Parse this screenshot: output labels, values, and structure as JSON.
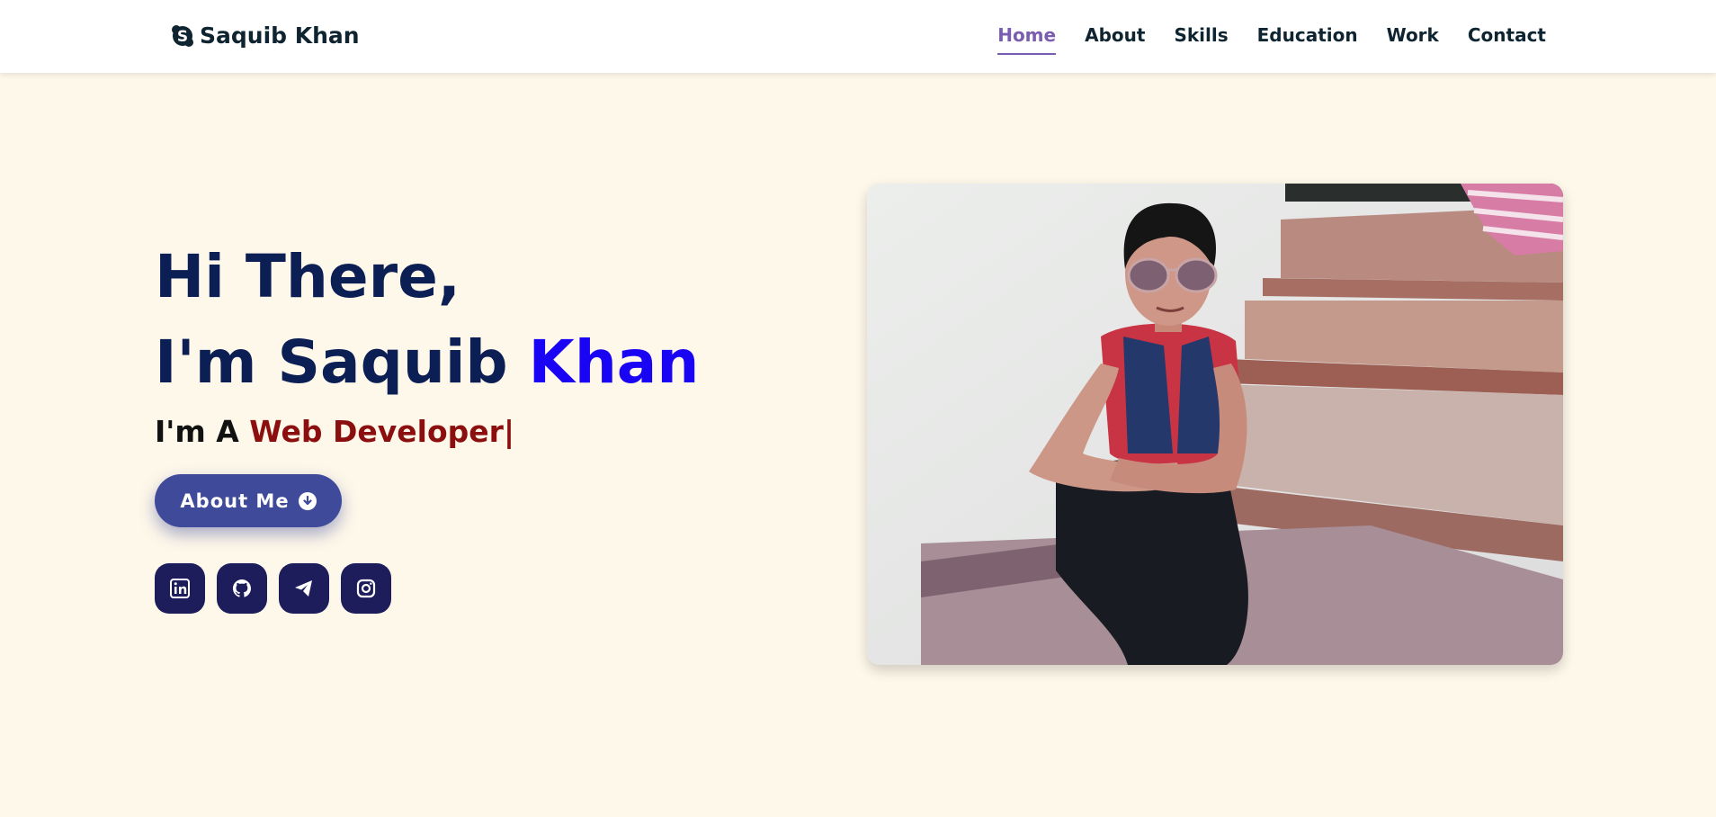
{
  "header": {
    "brand": "Saquib Khan",
    "nav": [
      "Home",
      "About",
      "Skills",
      "Education",
      "Work",
      "Contact"
    ],
    "active": "Home"
  },
  "hero": {
    "line1": "Hi There,",
    "line2_prefix": "I'm Saquib ",
    "line2_accent": "Khan",
    "role_prefix": "I'm A ",
    "role_typed": "Web Developer|",
    "button_label": "About Me",
    "socials": [
      "linkedin-icon",
      "github-icon",
      "telegram-icon",
      "instagram-icon"
    ]
  },
  "colors": {
    "background": "#fef8ea",
    "heading": "#0c1f55",
    "accent": "#1a04f4",
    "role_accent": "#8c0f0f",
    "button": "#3f4a9a",
    "nav_active": "#7a5cb0",
    "social_bg": "#1c1d5a"
  }
}
